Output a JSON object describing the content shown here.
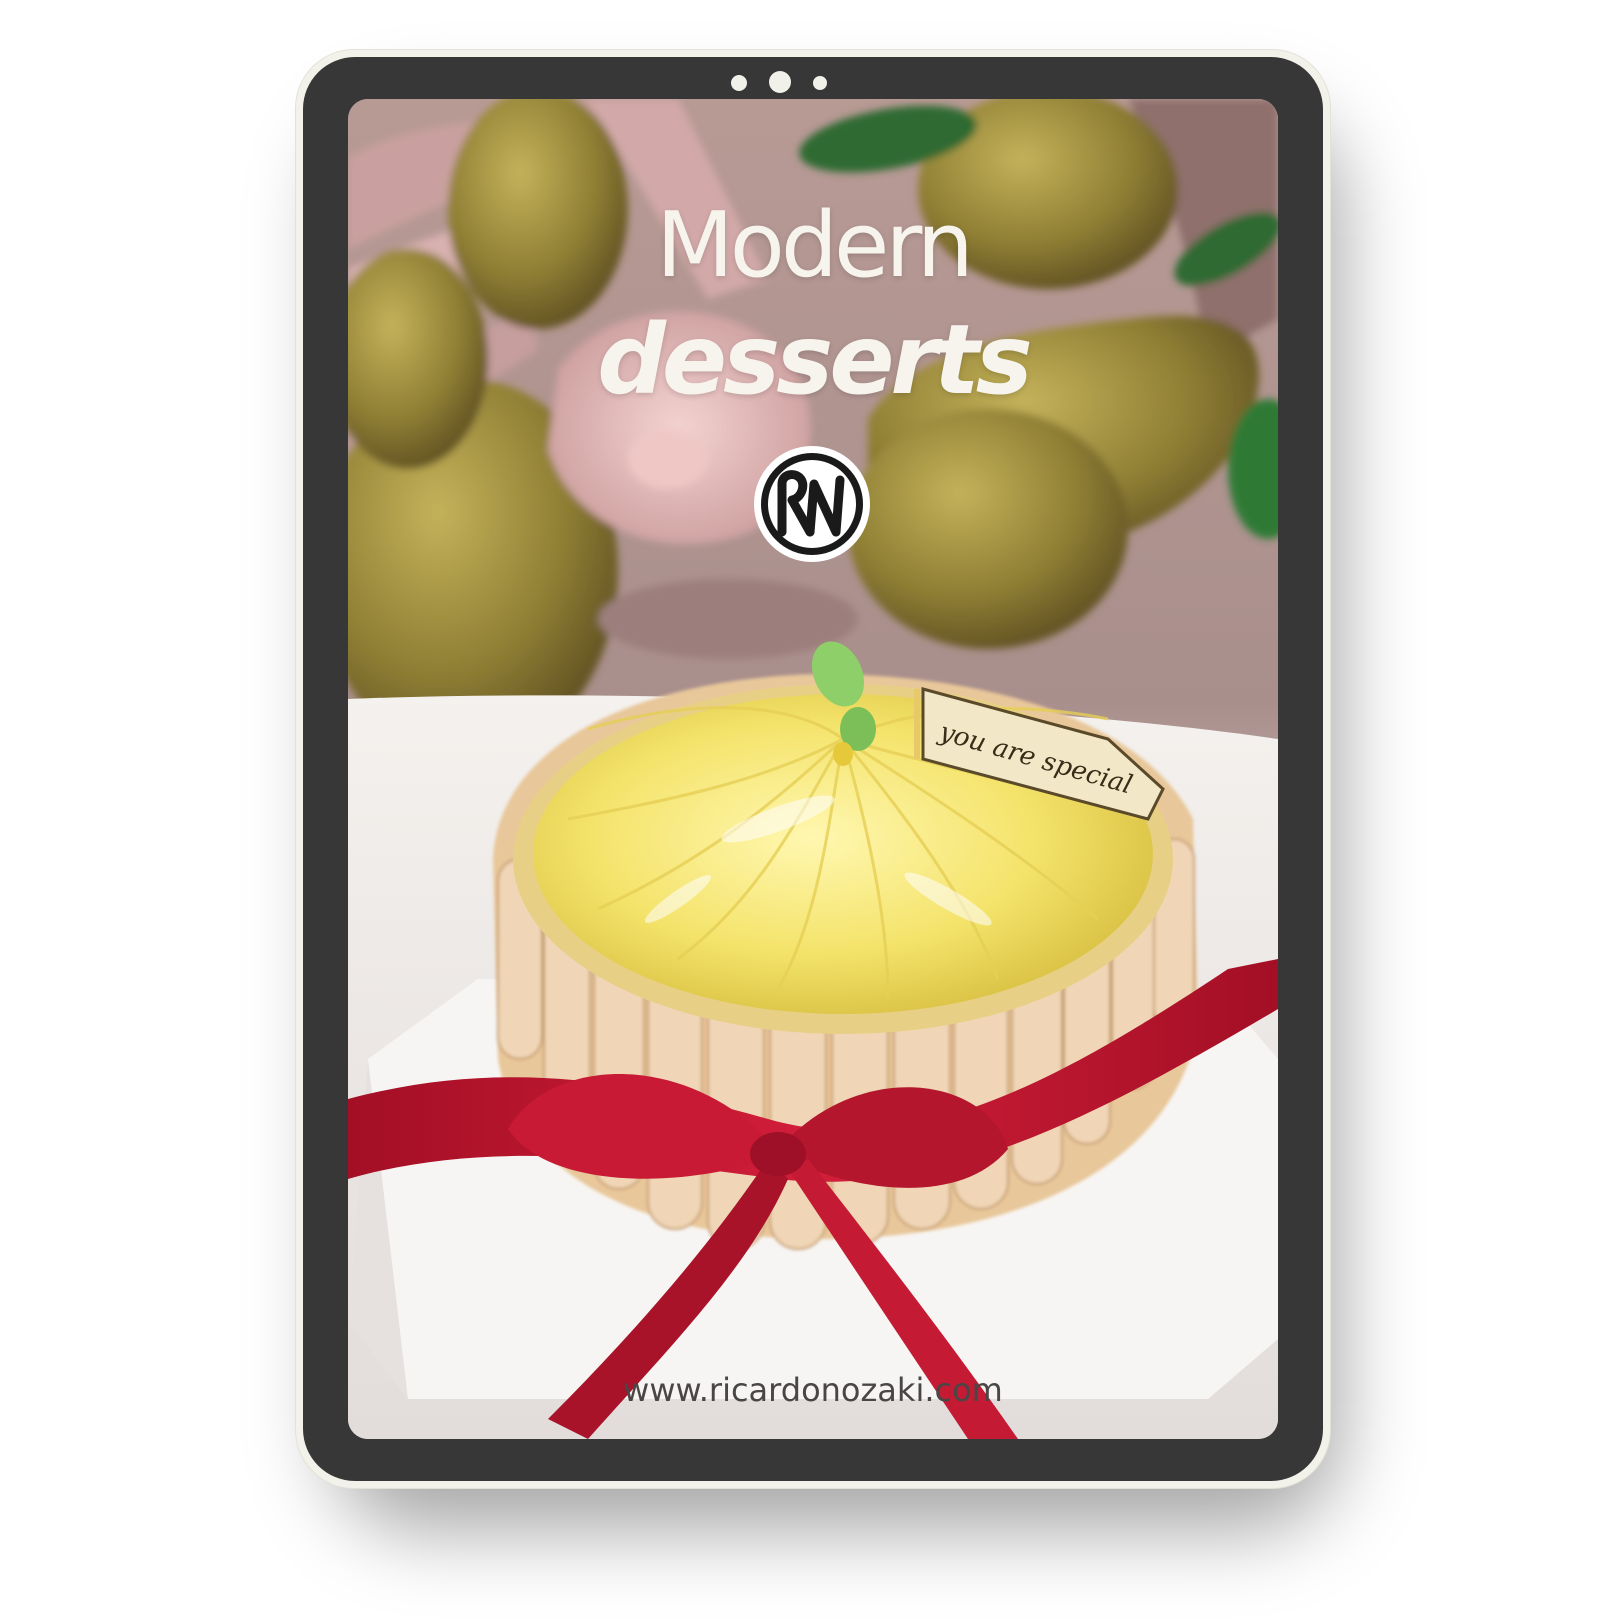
{
  "cover": {
    "title_line1": "Modern",
    "title_line2": "desserts",
    "logo_monogram": "RN",
    "tag_text": "you are special",
    "website": "www.ricardonozaki.com"
  },
  "colors": {
    "bezel": "#373737",
    "frame": "#f3f2ea",
    "title_text": "#f7f4ee",
    "ribbon": "#c81a34",
    "url_text": "#4a4646"
  }
}
